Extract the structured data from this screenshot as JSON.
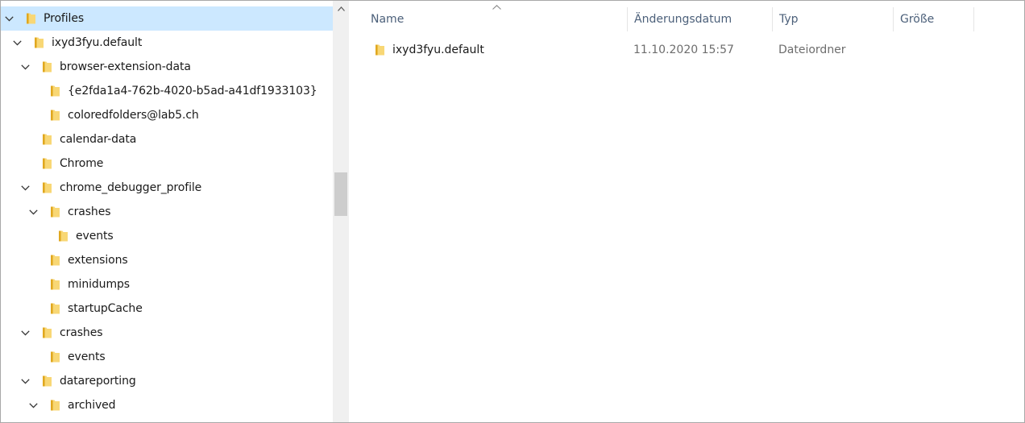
{
  "navigation_tree": {
    "items": [
      {
        "label": "Profiles",
        "state": "expanded",
        "selected": true
      },
      {
        "label": "ixyd3fyu.default",
        "state": "expanded",
        "selected": false
      },
      {
        "label": "browser-extension-data",
        "state": "expanded",
        "selected": false
      },
      {
        "label": "{e2fda1a4-762b-4020-b5ad-a41df1933103}",
        "state": "leaf",
        "selected": false
      },
      {
        "label": "coloredfolders@lab5.ch",
        "state": "leaf",
        "selected": false
      },
      {
        "label": "calendar-data",
        "state": "leaf",
        "selected": false
      },
      {
        "label": "Chrome",
        "state": "leaf",
        "selected": false
      },
      {
        "label": "chrome_debugger_profile",
        "state": "expanded",
        "selected": false
      },
      {
        "label": "crashes",
        "state": "expanded",
        "selected": false
      },
      {
        "label": "events",
        "state": "leaf",
        "selected": false
      },
      {
        "label": "extensions",
        "state": "leaf",
        "selected": false
      },
      {
        "label": "minidumps",
        "state": "leaf",
        "selected": false
      },
      {
        "label": "startupCache",
        "state": "leaf",
        "selected": false
      },
      {
        "label": "crashes",
        "state": "expanded",
        "selected": false
      },
      {
        "label": "events",
        "state": "leaf",
        "selected": false
      },
      {
        "label": "datareporting",
        "state": "expanded",
        "selected": false
      },
      {
        "label": "archived",
        "state": "expanded",
        "selected": false
      }
    ]
  },
  "details_view": {
    "columns": {
      "name": "Name",
      "date_modified": "Änderungsdatum",
      "type": "Typ",
      "size": "Größe"
    },
    "sorted_by": "name",
    "rows": [
      {
        "name": "ixyd3fyu.default",
        "date_modified": "11.10.2020 15:57",
        "type": "Dateiordner",
        "size": ""
      }
    ]
  },
  "colors": {
    "selection": "#cce8ff",
    "folder": "#f8d775",
    "folder_dark": "#e0a820",
    "header_text": "#4c607a"
  },
  "icons": {
    "folder": "folder-icon",
    "expand": "chevron-down-icon",
    "sort": "sort-ascending-icon",
    "scroll_up": "scroll-up-arrow-icon"
  }
}
